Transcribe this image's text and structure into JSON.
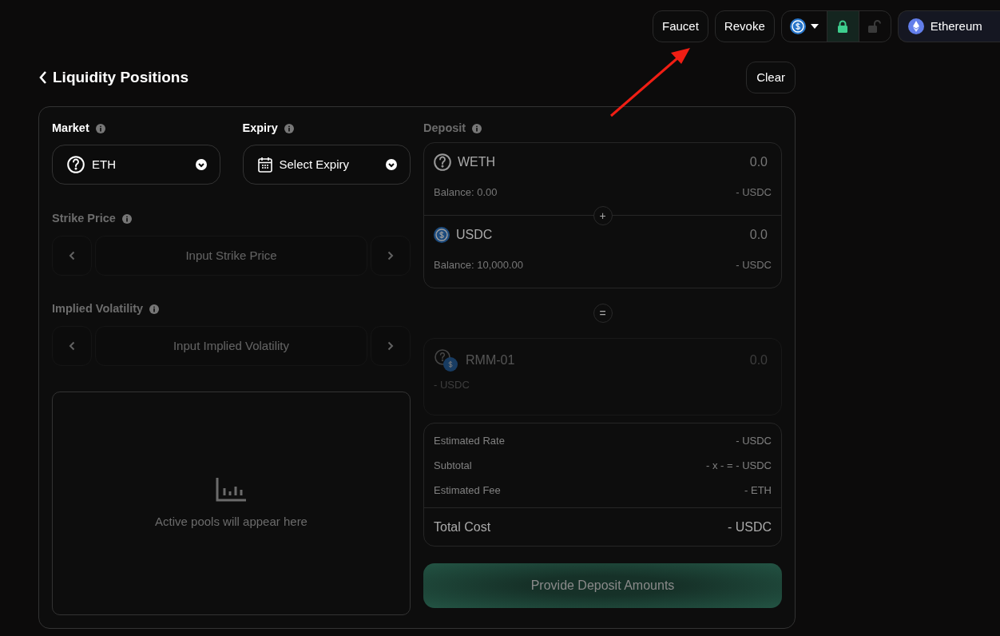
{
  "top_bar": {
    "buttons": [
      "Faucet",
      "Revoke"
    ],
    "lock_modes": [
      {
        "kind": "locked",
        "selected": true
      },
      {
        "kind": "unlocked",
        "selected": false
      }
    ],
    "network": "Ethereum"
  },
  "header": {
    "title": "Liquidity Positions",
    "clear_button": "Clear"
  },
  "selects": [
    {
      "kind": "market",
      "label": "Market",
      "value": "ETH"
    },
    {
      "kind": "expiry",
      "label": "Expiry",
      "value": "Select Expiry"
    }
  ],
  "steppers": [
    {
      "label": "Strike Price",
      "placeholder": "Input Strike Price",
      "disabled": true
    },
    {
      "label": "Implied Volatility",
      "placeholder": "Input Implied Volatility",
      "disabled": true
    }
  ],
  "pools_empty": "Active pools will appear here",
  "deposit": {
    "label": "Deposit",
    "tokens": [
      {
        "kind": "unknown",
        "symbol": "WETH",
        "amount": "0.0",
        "balance": "Balance: 0.00",
        "value": "- USDC"
      },
      {
        "kind": "usdc",
        "symbol": "USDC",
        "amount": "0.0",
        "balance": "Balance: 10,000.00",
        "value": "- USDC"
      }
    ],
    "plus": "+",
    "equals": "=",
    "result": {
      "symbol": "RMM-01",
      "amount": "0.0",
      "value": "- USDC"
    }
  },
  "summary": [
    {
      "label": "Estimated Rate",
      "value": "- USDC"
    },
    {
      "label": "Subtotal",
      "value": "- x - = - USDC"
    },
    {
      "label": "Estimated Fee",
      "value": "- ETH"
    }
  ],
  "total": {
    "label": "Total Cost",
    "value": "- USDC"
  },
  "submit": {
    "label": "Provide Deposit Amounts",
    "disabled": true
  },
  "annotation": {
    "kind": "arrow"
  }
}
